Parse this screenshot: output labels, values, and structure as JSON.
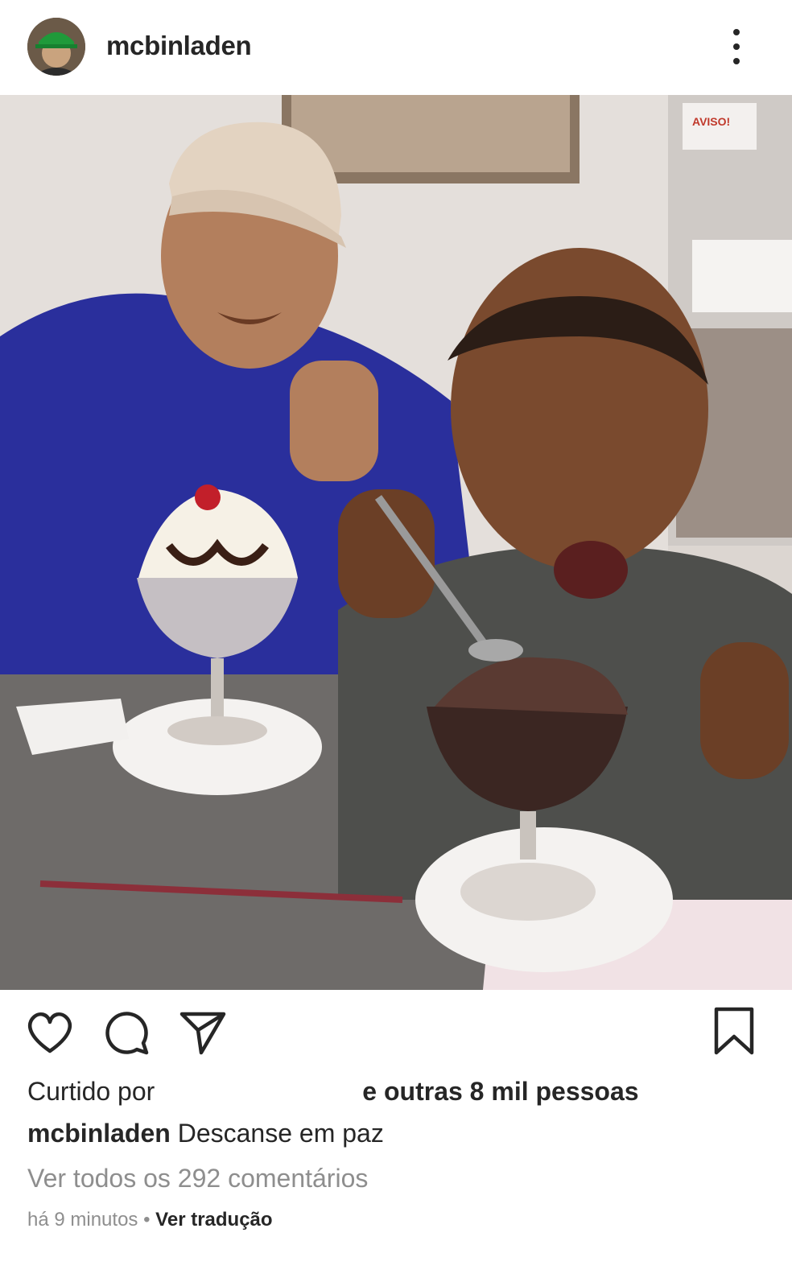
{
  "header": {
    "username": "mcbinladen"
  },
  "post": {
    "photo_sign_text": "AVISO!"
  },
  "actions": {
    "like": "heart-icon",
    "comment": "comment-icon",
    "share": "send-icon",
    "save": "bookmark-icon"
  },
  "likes": {
    "prefix": "Curtido por",
    "suffix": "e outras 8 mil pessoas"
  },
  "caption": {
    "username": "mcbinladen",
    "text": "Descanse em paz"
  },
  "comments": {
    "view_all": "Ver todos os 292 comentários"
  },
  "meta": {
    "time": "há 9 minutos",
    "separator": "•",
    "translate": "Ver tradução"
  }
}
